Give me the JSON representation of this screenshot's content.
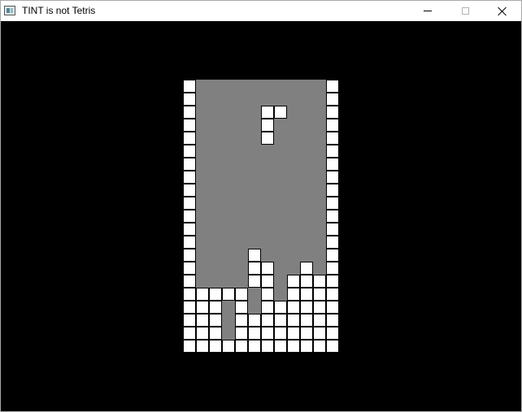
{
  "window": {
    "title": "TINT is not Tetris",
    "icon": "app-icon",
    "controls": [
      "minimize-icon",
      "maximize-icon",
      "close-icon"
    ]
  },
  "colors": {
    "background": "#000000",
    "board_empty": "#808080",
    "block": "#ffffff",
    "block_outline": "#000000"
  },
  "board": {
    "columns": 12,
    "rows": 21,
    "legend": "W = wall block, # = settled block, P = falling piece, . = empty",
    "grid": [
      "W..........W",
      "W..........W",
      "W.....PP...W",
      "W.....P....W",
      "W.....P....W",
      "W..........W",
      "W..........W",
      "W..........W",
      "W..........W",
      "W..........W",
      "W..........W",
      "W..........W",
      "W..........W",
      "W....#.....W",
      "W....##..#.W",
      "W....##.####",
      "W####.#.####",
      "W##.#.######",
      "W##.########",
      "W##.########",
      "WWWWWWWWWWWW"
    ]
  }
}
